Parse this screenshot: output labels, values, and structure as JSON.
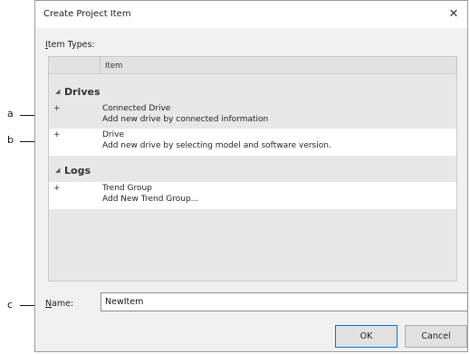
{
  "dialog": {
    "title": "Create Project Item",
    "close_glyph": "✕"
  },
  "types_label": {
    "mnemonic": "I",
    "rest": "tem  Types:"
  },
  "list": {
    "column_header": "Item",
    "groups": [
      {
        "name": "Drives",
        "items": [
          {
            "name": "Connected Drive",
            "description": "Add new drive by connected information"
          },
          {
            "name": "Drive",
            "description": "Add new drive by selecting model and software version."
          }
        ]
      },
      {
        "name": "Logs",
        "items": [
          {
            "name": "Trend Group",
            "description": "Add New Trend Group..."
          }
        ]
      }
    ]
  },
  "name_field": {
    "mnemonic": "N",
    "rest": "ame:",
    "value": "NewItem"
  },
  "buttons": {
    "ok": "OK",
    "cancel": "Cancel"
  },
  "callouts": {
    "a": "a",
    "b": "b",
    "c": "c"
  },
  "icons": {
    "collapse": "collapse-triangle-icon",
    "expand": "plus-icon",
    "close": "close-icon"
  }
}
